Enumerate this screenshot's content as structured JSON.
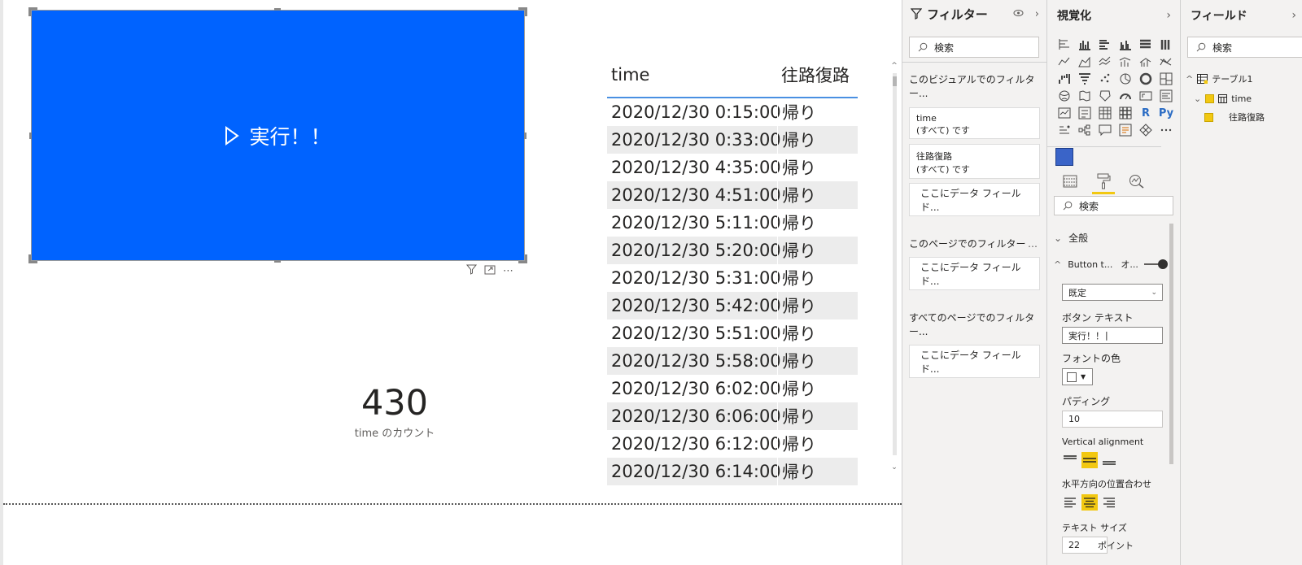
{
  "canvas": {
    "button_visual": {
      "label": "実行！！",
      "color": "#0063ff"
    },
    "card": {
      "value": "430",
      "label": "time のカウント"
    },
    "table": {
      "columns": [
        "time",
        "往路復路"
      ],
      "rows": [
        [
          "2020/12/30 0:15:00",
          "帰り"
        ],
        [
          "2020/12/30 0:33:00",
          "帰り"
        ],
        [
          "2020/12/30 4:35:00",
          "帰り"
        ],
        [
          "2020/12/30 4:51:00",
          "帰り"
        ],
        [
          "2020/12/30 5:11:00",
          "帰り"
        ],
        [
          "2020/12/30 5:20:00",
          "帰り"
        ],
        [
          "2020/12/30 5:31:00",
          "帰り"
        ],
        [
          "2020/12/30 5:42:00",
          "帰り"
        ],
        [
          "2020/12/30 5:51:00",
          "帰り"
        ],
        [
          "2020/12/30 5:58:00",
          "帰り"
        ],
        [
          "2020/12/30 6:02:00",
          "帰り"
        ],
        [
          "2020/12/30 6:06:00",
          "帰り"
        ],
        [
          "2020/12/30 6:12:00",
          "帰り"
        ],
        [
          "2020/12/30 6:14:00",
          "帰り"
        ]
      ]
    }
  },
  "filters": {
    "title": "フィルター",
    "search_placeholder": "検索",
    "visual_section": "このビジュアルでのフィルター...",
    "filter_cards": [
      {
        "field": "time",
        "state": "(すべて) です"
      },
      {
        "field": "往路復路",
        "state": "(すべて) です"
      }
    ],
    "drop_label": "ここにデータ フィールド...",
    "page_section": "このページでのフィルター",
    "all_pages_section": "すべてのページでのフィルター..."
  },
  "viz": {
    "title": "視覚化",
    "search_placeholder": "検索",
    "sections": {
      "general": "全般",
      "button_text": "Button t...",
      "button_text_toggle": "オ..."
    },
    "state_select": "既定",
    "labels": {
      "button_text": "ボタン テキスト",
      "font_color": "フォントの色",
      "padding": "パディング",
      "vertical_alignment": "Vertical alignment",
      "horizontal_alignment": "水平方向の位置合わせ",
      "text_size": "テキスト サイズ"
    },
    "values": {
      "button_text": "実行！！",
      "padding": "10",
      "text_size": "22",
      "text_size_unit": "ポイント"
    },
    "icons": [
      "R",
      "Py"
    ]
  },
  "fields": {
    "title": "フィールド",
    "search_placeholder": "検索",
    "table_name": "テーブル1",
    "field_time": "time",
    "field_route": "往路復路"
  },
  "colors": {
    "accent": "#f2c811",
    "button_blue": "#0063ff",
    "table_header_line": "#4a90e2"
  }
}
